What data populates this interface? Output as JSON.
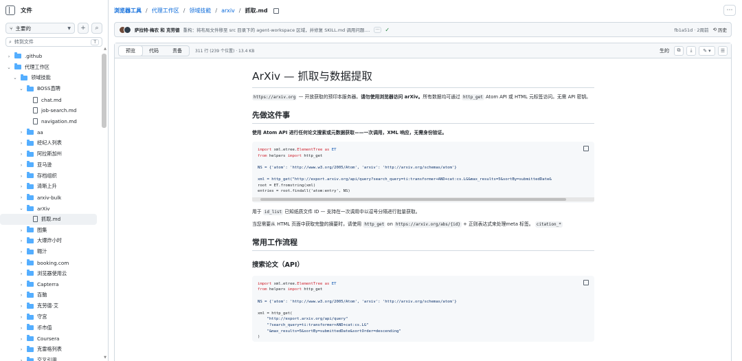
{
  "sidebar": {
    "title": "文件",
    "branch": "主要的",
    "search_placeholder": "转到文件",
    "search_kbd": "T",
    "tree": [
      {
        "label": ".github",
        "type": "folder",
        "depth": 0,
        "expanded": false
      },
      {
        "label": "代理工作区",
        "type": "folder",
        "depth": 0,
        "expanded": true
      },
      {
        "label": "领域技能",
        "type": "folder",
        "depth": 1,
        "expanded": true
      },
      {
        "label": "BOSS直聘",
        "type": "folder",
        "depth": 2,
        "expanded": true
      },
      {
        "label": "chat.md",
        "type": "file",
        "depth": 3
      },
      {
        "label": "job-search.md",
        "type": "file",
        "depth": 3
      },
      {
        "label": "navigation.md",
        "type": "file",
        "depth": 3
      },
      {
        "label": "aa",
        "type": "folder",
        "depth": 2,
        "expanded": false
      },
      {
        "label": "经纪人列表",
        "type": "folder",
        "depth": 2,
        "expanded": false
      },
      {
        "label": "阿拉斯加州",
        "type": "folder",
        "depth": 2,
        "expanded": false
      },
      {
        "label": "亚马逊",
        "type": "folder",
        "depth": 2,
        "expanded": false
      },
      {
        "label": "存档组织",
        "type": "folder",
        "depth": 2,
        "expanded": false
      },
      {
        "label": "清晰上升",
        "type": "folder",
        "depth": 2,
        "expanded": false
      },
      {
        "label": "arxiv-bulk",
        "type": "folder",
        "depth": 2,
        "expanded": false
      },
      {
        "label": "arXiv",
        "type": "folder",
        "depth": 2,
        "expanded": true
      },
      {
        "label": "抓取.md",
        "type": "file",
        "depth": 3,
        "selected": true
      },
      {
        "label": "图集",
        "type": "folder",
        "depth": 2,
        "expanded": false
      },
      {
        "label": "大爆炸小时",
        "type": "folder",
        "depth": 2,
        "expanded": false
      },
      {
        "label": "翱汁",
        "type": "folder",
        "depth": 2,
        "expanded": false
      },
      {
        "label": "booking.com",
        "type": "folder",
        "depth": 2,
        "expanded": false
      },
      {
        "label": "浏览器使用云",
        "type": "folder",
        "depth": 2,
        "expanded": false
      },
      {
        "label": "Capterra",
        "type": "folder",
        "depth": 2,
        "expanded": false
      },
      {
        "label": "百脑",
        "type": "folder",
        "depth": 2,
        "expanded": false
      },
      {
        "label": "克劳德·艾",
        "type": "folder",
        "depth": 2,
        "expanded": false
      },
      {
        "label": "守宫",
        "type": "folder",
        "depth": 2,
        "expanded": false
      },
      {
        "label": "币市值",
        "type": "folder",
        "depth": 2,
        "expanded": false
      },
      {
        "label": "Coursera",
        "type": "folder",
        "depth": 2,
        "expanded": false
      },
      {
        "label": "克雷格列表",
        "type": "folder",
        "depth": 2,
        "expanded": false
      },
      {
        "label": "交叉引用",
        "type": "folder",
        "depth": 2,
        "expanded": false
      }
    ]
  },
  "breadcrumb": {
    "root": "浏览器工具",
    "level1": "代理工作区",
    "level2": "领域技能",
    "level3": "arxiv",
    "current": "抓取.md"
  },
  "commit": {
    "authors": "萨拉特·梅农 和 克劳德",
    "message": "重构：将布局文件移至 src 目录下的 agent-workspace 区域，并修复 SKILL.md 调用问题....",
    "hash_time": "fb1a51d · 2周前",
    "history_label": "历史"
  },
  "file_toolbar": {
    "tabs": [
      "预览",
      "代码",
      "责备"
    ],
    "meta": "311 行 (239 个位置) · 13.4 KB",
    "raw_label": "生的"
  },
  "article": {
    "h1": "ArXiv — 抓取与数据提取",
    "intro_code": "https://arxiv.org",
    "intro_text1": " — 开放获取的预印本服务器。",
    "intro_bold": "请勿使用浏览器访问 arXiv。",
    "intro_text2": "所有数据均可通过 ",
    "intro_code2": "http_get",
    "intro_text3": " Atom API 或 HTML 元标签访问。无需 API 密钥。",
    "h2_first": "先做这件事",
    "first_bold": "使用 Atom API 进行任何论文搜索或元数据获取——一次调用，XML 响应，无需身份验证。",
    "p_idlist_code": "id_list",
    "p_idlist_text": " 已知纸质文件 ID — 支持在一次调用中以逗号分隔进行批量获取。",
    "p_html_pre": "当您需要从 HTML 页面中获取完整的摘要时，请使用 ",
    "p_html_code1": "http_get",
    "p_html_on": " on ",
    "p_html_code2": "https://arxiv.org/abs/{id}",
    "p_html_post": " + 正则表达式来处理meta 标签。 ",
    "p_html_code3": "citation_*",
    "h2_workflow": "常用工作流程",
    "h3_search": "搜索论文（API）"
  },
  "code1": {
    "l1_kw": "import",
    "l1_mod": " xml.etree.",
    "l1_cls": "ElementTree",
    "l1_as": " as ",
    "l1_alias": "ET",
    "l2_kw": "from",
    "l2_mod": " helpers ",
    "l2_import": "import",
    "l2_name": " http_get",
    "l3": "NS = {'atom': 'http://www.w3.org/2005/Atom', 'arxiv': 'http://arxiv.org/schemas/atom'}",
    "l4": "xml = http_get(\"http://export.arxiv.org/api/query?search_query=ti:transformer+AND+cat:cs.LG&max_results=5&sortBy=submittedDate&",
    "l5": "root = ET.fromstring(xml)",
    "l6": "entries = root.findall('atom:entry', NS)"
  },
  "code2": {
    "l3": "NS = {'atom': 'http://www.w3.org/2005/Atom', 'arxiv': 'http://arxiv.org/schemas/atom'}",
    "l4": "xml = http_get(",
    "l5": "    \"http://export.arxiv.org/api/query\"",
    "l6": "    \"?search_query=ti:transformer+AND+cat:cs.LG\"",
    "l7": "    \"&max_results=5&sortBy=submittedDate&sortOrder=descending\"",
    "l8": ")"
  }
}
